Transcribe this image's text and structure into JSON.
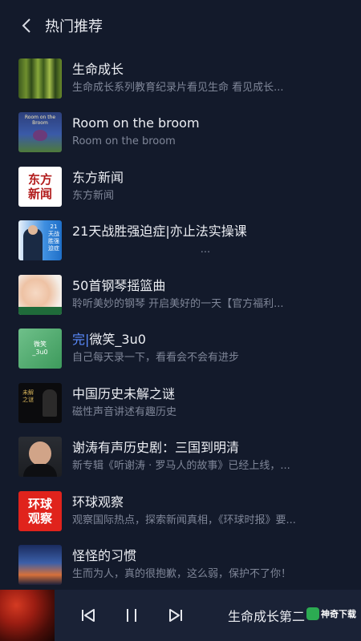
{
  "header": {
    "title": "热门推荐",
    "back_icon": "chevron-left-icon"
  },
  "items": [
    {
      "name": "生命成长",
      "sub": "生命成长系列教育纪录片看见生命 看见成长..."
    },
    {
      "name": "Room on the broom",
      "sub": "Room on the broom",
      "cover_text": "Room on the Broom"
    },
    {
      "name": "东方新闻",
      "sub": "东方新闻",
      "cover_text": "东方新闻"
    },
    {
      "name": "21天战胜强迫症|亦止法实操课",
      "sub": "...",
      "cover_text": "21天战胜强迫症"
    },
    {
      "name": "50首钢琴摇篮曲",
      "sub": "聆听美妙的钢琴 开启美好的一天【官方福利..."
    },
    {
      "name_prefix": "完|",
      "name": "微笑_3u0",
      "sub": "自己每天录一下，看看会不会有进步",
      "cover_text": "微笑_3u0"
    },
    {
      "name": "中国历史未解之谜",
      "sub": "磁性声音讲述有趣历史",
      "cover_text": "未解之谜"
    },
    {
      "name": "谢涛有声历史剧：三国到明清",
      "sub": "新专辑《听谢涛 · 罗马人的故事》已经上线，..."
    },
    {
      "name": "环球观察",
      "sub": "观察国际热点，探索新闻真相，《环球时报》要...",
      "cover_text": "环球观察"
    },
    {
      "name": "怪怪的习惯",
      "sub": "生而为人，真的很抱歉，这么弱，保护不了你！"
    }
  ],
  "player": {
    "now_playing": "生命成长第二",
    "prev_icon": "skip-previous-icon",
    "pause_icon": "pause-icon",
    "next_icon": "skip-next-icon",
    "watermark": "神奇下载"
  },
  "colors": {
    "background": "#131a2b",
    "accent": "#5b8cff",
    "subtext": "#7f8698"
  }
}
